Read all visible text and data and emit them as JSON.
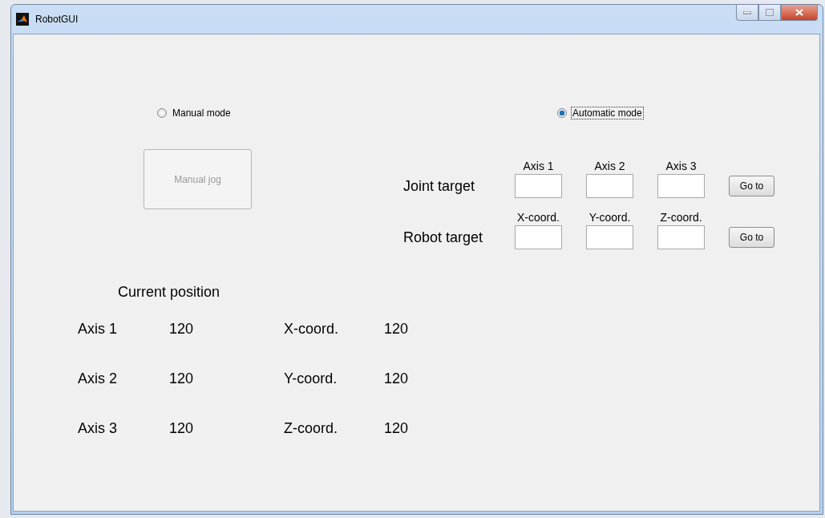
{
  "window": {
    "title": "RobotGUI"
  },
  "modes": [
    {
      "label": "Manual mode",
      "selected": false
    },
    {
      "label": "Automatic mode",
      "selected": true
    }
  ],
  "manual_jog": {
    "label": "Manual jog",
    "disabled": true
  },
  "targets": [
    {
      "label": "Joint target",
      "columns": [
        "Axis 1",
        "Axis 2",
        "Axis 3"
      ],
      "button": "Go to"
    },
    {
      "label": "Robot target",
      "columns": [
        "X-coord.",
        "Y-coord.",
        "Z-coord."
      ],
      "button": "Go to"
    }
  ],
  "current_position": {
    "title": "Current position",
    "rows": [
      {
        "axis": "Axis 1",
        "axis_value": "120",
        "coord": "X-coord.",
        "coord_value": "120"
      },
      {
        "axis": "Axis 2",
        "axis_value": "120",
        "coord": "Y-coord.",
        "coord_value": "120"
      },
      {
        "axis": "Axis 3",
        "axis_value": "120",
        "coord": "Z-coord.",
        "coord_value": "120"
      }
    ]
  }
}
